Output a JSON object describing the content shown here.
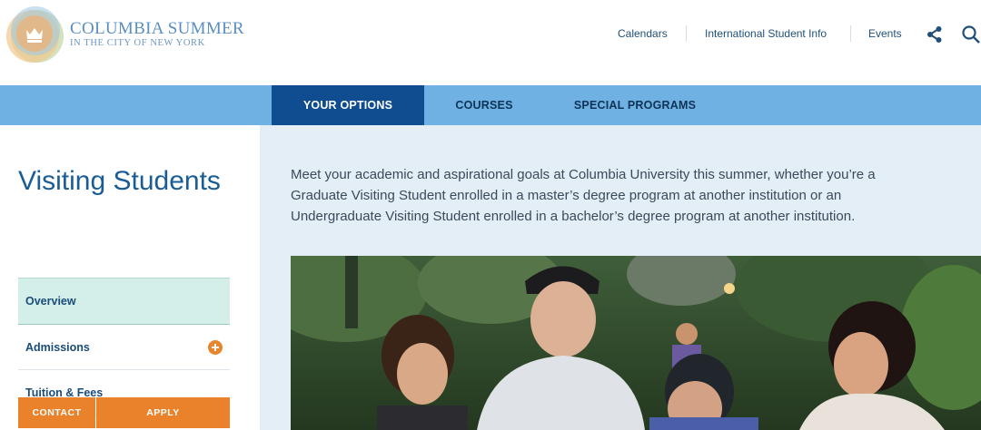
{
  "brand": {
    "title": "COLUMBIA SUMMER",
    "subtitle": "IN THE CITY OF NEW YORK"
  },
  "top_nav": {
    "items": [
      "Calendars",
      "International Student Info",
      "Events"
    ],
    "share_icon": "share-icon",
    "search_icon": "search-icon"
  },
  "main_nav": {
    "tabs": [
      "YOUR OPTIONS",
      "COURSES",
      "SPECIAL PROGRAMS"
    ],
    "active_tab": "YOUR OPTIONS"
  },
  "page": {
    "title": "Visiting Students",
    "intro": "Meet your academic and aspirational goals at Columbia University this summer, whether you’re a Graduate Visiting Student enrolled in a master’s degree program at another institution or an Undergraduate Visiting Student enrolled in a bachelor’s degree program at another institution."
  },
  "sidebar": {
    "items": [
      "Overview",
      "Admissions",
      "Tuition & Fees"
    ],
    "active_item": "Overview",
    "expand_icon": "plus-icon"
  },
  "actions": {
    "contact_label": "CONTACT",
    "apply_label": "APPLY"
  },
  "colors": {
    "brand_blue": "#5b8fc0",
    "nav_bar": "#6fb1e2",
    "active_tab": "#0f4c90",
    "accent_orange": "#e9822a",
    "content_bg": "#e4eef6",
    "active_side_item": "#d4efe9"
  }
}
